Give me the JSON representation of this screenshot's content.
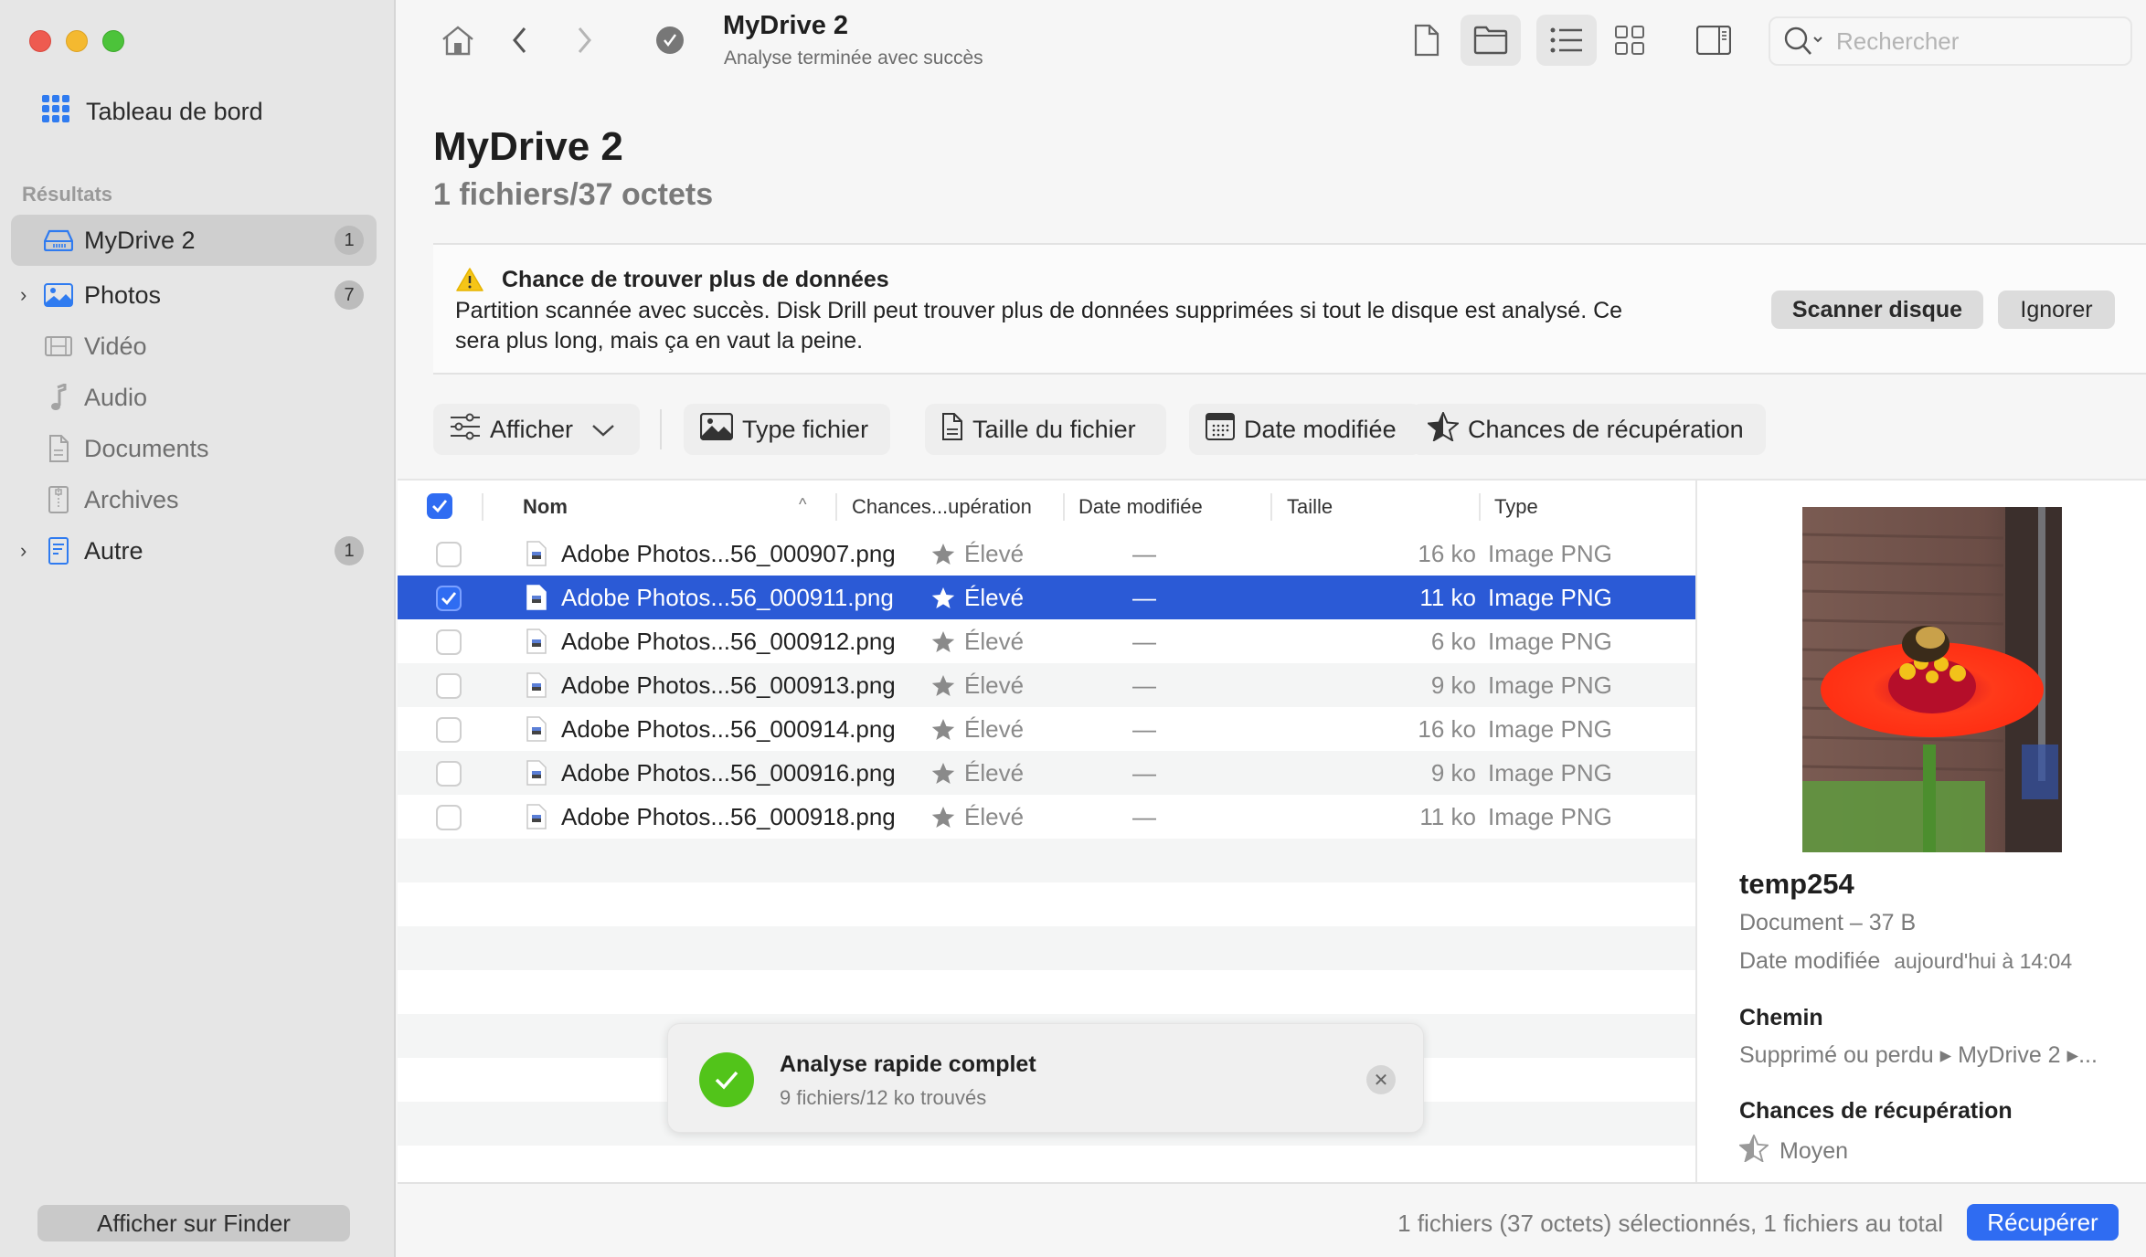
{
  "window": {
    "title": "MyDrive 2",
    "subtitle": "Analyse terminée avec succès"
  },
  "sidebar": {
    "dashboard_label": "Tableau de bord",
    "section_label": "Résultats",
    "items": [
      {
        "label": "MyDrive 2",
        "badge": "1",
        "icon": "drive-icon",
        "active": true,
        "expandable": false
      },
      {
        "label": "Photos",
        "badge": "7",
        "icon": "photo-icon",
        "active": false,
        "expandable": true
      },
      {
        "label": "Vidéo",
        "badge": "",
        "icon": "film-icon",
        "active": false,
        "expandable": false
      },
      {
        "label": "Audio",
        "badge": "",
        "icon": "music-note-icon",
        "active": false,
        "expandable": false
      },
      {
        "label": "Documents",
        "badge": "",
        "icon": "document-icon",
        "active": false,
        "expandable": false
      },
      {
        "label": "Archives",
        "badge": "",
        "icon": "archive-zip-icon",
        "active": false,
        "expandable": false
      },
      {
        "label": "Autre",
        "badge": "1",
        "icon": "other-file-icon",
        "active": false,
        "expandable": true
      }
    ],
    "finder_button": "Afficher sur Finder"
  },
  "toolbar": {
    "search_placeholder": "Rechercher",
    "search_value": ""
  },
  "header": {
    "title": "MyDrive 2",
    "summary": "1 fichiers/37 octets"
  },
  "banner": {
    "title": "Chance de trouver plus de données",
    "text": "Partition scannée avec succès. Disk Drill peut trouver plus de données supprimées si tout le disque est analysé. Ce sera plus long, mais ça en vaut la peine.",
    "scan_button": "Scanner disque",
    "ignore_button": "Ignorer"
  },
  "filters": {
    "show_label": "Afficher",
    "chips": [
      "Type fichier",
      "Taille du fichier",
      "Date modifiée",
      "Chances de récupération"
    ]
  },
  "table": {
    "columns": [
      "Nom",
      "Chances...upération",
      "Date modifiée",
      "Taille",
      "Type"
    ],
    "rows": [
      {
        "name": "Adobe Photos...56_000907.png",
        "chance": "Élevé",
        "date": "—",
        "size": "16 ko",
        "type": "Image PNG",
        "checked": false,
        "selected": false
      },
      {
        "name": "Adobe Photos...56_000911.png",
        "chance": "Élevé",
        "date": "—",
        "size": "11 ko",
        "type": "Image PNG",
        "checked": true,
        "selected": true
      },
      {
        "name": "Adobe Photos...56_000912.png",
        "chance": "Élevé",
        "date": "—",
        "size": "6 ko",
        "type": "Image PNG",
        "checked": false,
        "selected": false
      },
      {
        "name": "Adobe Photos...56_000913.png",
        "chance": "Élevé",
        "date": "—",
        "size": "9 ko",
        "type": "Image PNG",
        "checked": false,
        "selected": false
      },
      {
        "name": "Adobe Photos...56_000914.png",
        "chance": "Élevé",
        "date": "—",
        "size": "16 ko",
        "type": "Image PNG",
        "checked": false,
        "selected": false
      },
      {
        "name": "Adobe Photos...56_000916.png",
        "chance": "Élevé",
        "date": "—",
        "size": "9 ko",
        "type": "Image PNG",
        "checked": false,
        "selected": false
      },
      {
        "name": "Adobe Photos...56_000918.png",
        "chance": "Élevé",
        "date": "—",
        "size": "11 ko",
        "type": "Image PNG",
        "checked": false,
        "selected": false
      }
    ]
  },
  "preview": {
    "name": "temp254",
    "kind_size": "Document – 37 B",
    "date_label": "Date modifiée",
    "date_value": "aujourd'hui à 14:04",
    "path_label": "Chemin",
    "path_value": "Supprimé ou perdu ▸ MyDrive 2 ▸...",
    "chance_label": "Chances de récupération",
    "chance_value": "Moyen"
  },
  "toast": {
    "title": "Analyse rapide complet",
    "subtitle": "9 fichiers/12 ko trouvés"
  },
  "footer": {
    "status": "1 fichiers (37 octets) sélectionnés, 1 fichiers au total",
    "recover_button": "Récupérer"
  },
  "colors": {
    "accent": "#2f6cf2",
    "selection": "#2b5ad6",
    "success": "#52c41a",
    "warning": "#f5c518"
  }
}
